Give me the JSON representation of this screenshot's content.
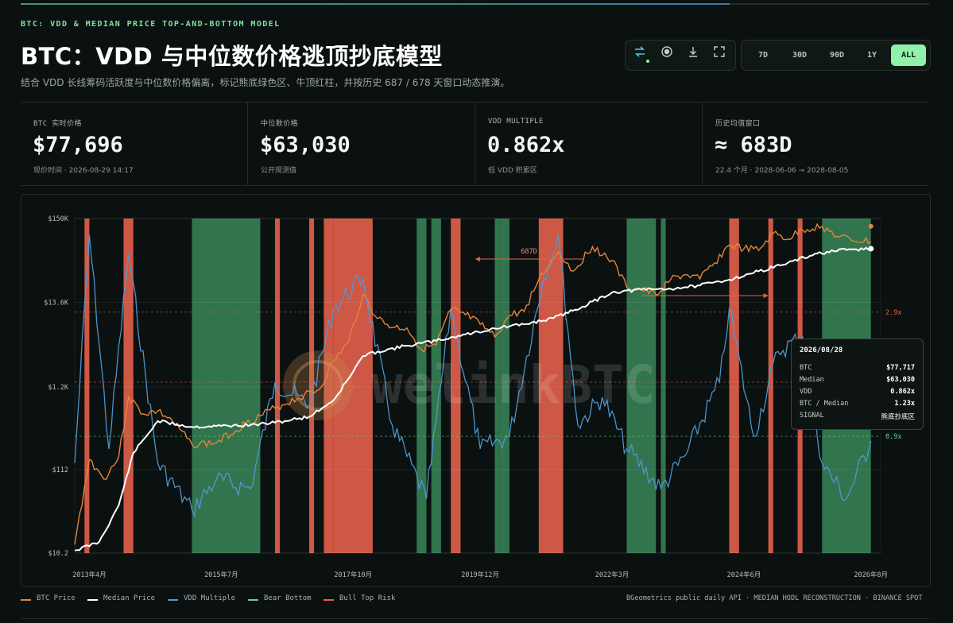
{
  "header": {
    "eyebrow": "BTC: VDD & MEDIAN PRICE TOP-AND-BOTTOM MODEL",
    "title": "BTC：VDD 与中位数价格逃顶抄底模型",
    "subtitle": "结合 VDD 长线筹码活跃度与中位数价格偏离，标记熊底绿色区、牛顶红柱，并按历史 687 / 678 天窗口动态推演。"
  },
  "toolbar": {
    "icons": [
      "swap-icon",
      "record-icon",
      "download-icon",
      "fullscreen-icon"
    ],
    "ranges": [
      "7D",
      "30D",
      "90D",
      "1Y",
      "ALL"
    ],
    "active_range": "ALL"
  },
  "stats": [
    {
      "label": "BTC 实时价格",
      "value": "$77,696",
      "sub": "现价时间 · 2026-08-29 14:17"
    },
    {
      "label": "中位数价格",
      "value": "$63,030",
      "sub": "公开观测值"
    },
    {
      "label": "VDD MULTIPLE",
      "value": "0.862x",
      "sub": "低 VDD 积累区"
    },
    {
      "label": "历史均值窗口",
      "value": "≈  683D",
      "sub": "22.4 个月 · 2028-06-06 → 2028-08-05"
    }
  ],
  "tooltip": {
    "date": "2026/08/28",
    "rows": [
      {
        "k": "BTC",
        "v": "$77,717"
      },
      {
        "k": "Median",
        "v": "$63,030"
      },
      {
        "k": "VDD",
        "v": "0.862x"
      },
      {
        "k": "BTC / Median",
        "v": "1.23x"
      },
      {
        "k": "SIGNAL",
        "v": "熊底抄底区"
      }
    ]
  },
  "legend": [
    {
      "name": "BTC Price",
      "color": "#e5843a"
    },
    {
      "name": "Median Price",
      "color": "#ffffff"
    },
    {
      "name": "VDD Multiple",
      "color": "#4f9ad6"
    },
    {
      "name": "Bear Bottom",
      "color": "#5fd38a"
    },
    {
      "name": "Bull Top Risk",
      "color": "#e8604c"
    }
  ],
  "source": "BGeometrics public daily API · MEDIAN HODL RECONSTRUCTION · BINANCE SPOT",
  "watermark": "welinkBTC",
  "chart_data": {
    "type": "line",
    "y_scale": "log",
    "y_ticks": [
      "$150K",
      "$13.6K",
      "$1.2K",
      "$112",
      "$10.2"
    ],
    "x_ticks": [
      "2013年4月",
      "2015年7月",
      "2017年10月",
      "2019年12月",
      "2022年3月",
      "2024年6月",
      "2026年8月"
    ],
    "x_range": [
      "2013-01",
      "2026-10"
    ],
    "vdd_reference_lines": [
      {
        "label": "2.9x",
        "value": 2.9,
        "color": "#e8604c"
      },
      {
        "label": "1.5x",
        "value": 1.5,
        "color": "#e8604c"
      },
      {
        "label": "0.9x",
        "value": 0.9,
        "color": "#5fd38a"
      }
    ],
    "annotation": {
      "label": "687D",
      "from": "2021-09",
      "to": "2019-11"
    },
    "bear_bottom_zones": [
      [
        "2015-01",
        "2016-03"
      ],
      [
        "2018-11",
        "2019-01"
      ],
      [
        "2019-02",
        "2019-04"
      ],
      [
        "2020-03",
        "2020-04"
      ],
      [
        "2020-04",
        "2020-06"
      ],
      [
        "2022-06",
        "2022-12"
      ],
      [
        "2023-01",
        "2023-02"
      ],
      [
        "2025-10",
        "2026-08"
      ]
    ],
    "bull_top_zones": [
      [
        "2013-03",
        "2013-04"
      ],
      [
        "2013-11",
        "2014-01"
      ],
      [
        "2016-06",
        "2016-07"
      ],
      [
        "2017-01",
        "2017-02"
      ],
      [
        "2017-04",
        "2017-06"
      ],
      [
        "2017-06",
        "2018-02"
      ],
      [
        "2019-06",
        "2019-08"
      ],
      [
        "2020-12",
        "2021-05"
      ],
      [
        "2024-03",
        "2024-05"
      ],
      [
        "2024-11",
        "2024-12"
      ],
      [
        "2025-05",
        "2025-06"
      ]
    ],
    "series": [
      {
        "name": "BTC Price",
        "color": "#e5843a",
        "x": [
          "2013-01",
          "2013-04",
          "2013-07",
          "2013-10",
          "2013-12",
          "2014-03",
          "2014-06",
          "2014-09",
          "2015-01",
          "2015-06",
          "2015-12",
          "2016-06",
          "2016-12",
          "2017-03",
          "2017-06",
          "2017-09",
          "2017-12",
          "2018-03",
          "2018-06",
          "2018-09",
          "2018-12",
          "2019-03",
          "2019-06",
          "2019-09",
          "2019-12",
          "2020-03",
          "2020-06",
          "2020-09",
          "2020-12",
          "2021-04",
          "2021-07",
          "2021-11",
          "2022-03",
          "2022-06",
          "2022-09",
          "2022-12",
          "2023-03",
          "2023-06",
          "2023-09",
          "2023-12",
          "2024-03",
          "2024-06",
          "2024-09",
          "2024-12",
          "2025-03",
          "2025-06",
          "2025-10",
          "2026-01",
          "2026-04",
          "2026-08"
        ],
        "values": [
          13,
          150,
          85,
          160,
          900,
          550,
          600,
          450,
          230,
          240,
          420,
          650,
          950,
          1100,
          2500,
          4300,
          17000,
          8500,
          6600,
          6500,
          3500,
          4000,
          11000,
          9500,
          7200,
          5000,
          9300,
          10500,
          26000,
          58000,
          33000,
          67000,
          45000,
          21000,
          19500,
          16800,
          26000,
          30000,
          26500,
          42000,
          70000,
          63000,
          60000,
          98000,
          83000,
          108000,
          120000,
          90000,
          80000,
          77700
        ]
      },
      {
        "name": "Median Price",
        "color": "#ffffff",
        "x": [
          "2013-01",
          "2013-06",
          "2013-10",
          "2014-01",
          "2014-06",
          "2015-01",
          "2015-06",
          "2016-01",
          "2016-06",
          "2017-01",
          "2017-06",
          "2017-09",
          "2017-12",
          "2018-03",
          "2018-09",
          "2019-03",
          "2019-09",
          "2020-03",
          "2020-09",
          "2021-03",
          "2021-09",
          "2022-03",
          "2022-09",
          "2023-03",
          "2023-09",
          "2024-03",
          "2024-09",
          "2025-03",
          "2025-09",
          "2026-03",
          "2026-08"
        ],
        "values": [
          11,
          14,
          40,
          180,
          450,
          380,
          390,
          400,
          430,
          510,
          820,
          1500,
          2900,
          3300,
          3900,
          4500,
          5400,
          6400,
          7200,
          8600,
          12000,
          18000,
          19500,
          20000,
          22000,
          26000,
          33000,
          42000,
          55000,
          61000,
          63030
        ]
      },
      {
        "name": "VDD Multiple",
        "color": "#4f9ad6",
        "x": [
          "2013-01",
          "2013-04",
          "2013-08",
          "2013-12",
          "2014-06",
          "2015-01",
          "2015-06",
          "2016-01",
          "2016-06",
          "2017-01",
          "2017-06",
          "2017-12",
          "2018-06",
          "2019-01",
          "2019-06",
          "2019-12",
          "2020-06",
          "2021-01",
          "2021-04",
          "2021-08",
          "2022-01",
          "2022-06",
          "2023-01",
          "2023-06",
          "2024-01",
          "2024-03",
          "2024-08",
          "2025-01",
          "2025-06",
          "2025-10",
          "2026-03",
          "2026-08"
        ],
        "values": [
          0.7,
          6,
          0.8,
          5,
          0.7,
          0.45,
          0.6,
          0.55,
          1.5,
          1.2,
          3,
          4,
          1,
          0.5,
          3,
          0.8,
          0.9,
          4,
          6,
          1,
          1.3,
          0.8,
          0.55,
          0.75,
          1.5,
          3,
          0.9,
          2,
          2.3,
          0.7,
          0.5,
          0.862
        ]
      }
    ]
  }
}
